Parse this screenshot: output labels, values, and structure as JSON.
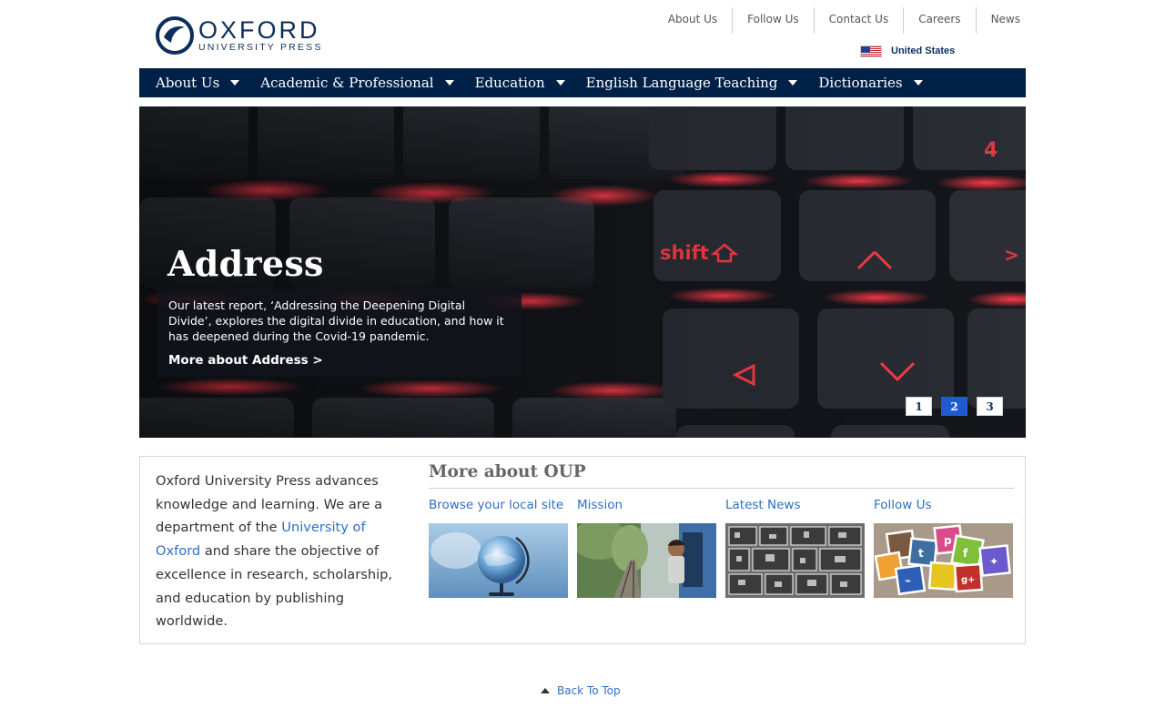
{
  "header": {
    "logo": {
      "word": "OXFORD",
      "sub": "UNIVERSITY PRESS"
    },
    "utility_links": [
      "About Us",
      "Follow Us",
      "Contact Us",
      "Careers",
      "News"
    ],
    "region": {
      "label": "United States",
      "icon": "us-flag-icon"
    }
  },
  "nav": {
    "items": [
      "About Us",
      "Academic & Professional",
      "Education",
      "English Language Teaching",
      "Dictionaries"
    ],
    "dropdown_icon": "caret-down-icon"
  },
  "hero": {
    "title": "Address",
    "description": "Our latest report, ‘Addressing the Deepening Digital Divide’, explores the digital divide in education, and how it has deepened during the Covid-19 pandemic.",
    "link": "More about Address >",
    "pager": [
      "1",
      "2",
      "3"
    ],
    "active_page": "2",
    "image_icon": "keyboard-photo-icon"
  },
  "intro": {
    "text_before": "Oxford University Press advances knowledge and learning. We are a department of the ",
    "link": "University of Oxford",
    "text_after": " and share the objective of excellence in research, scholarship, and education by publishing worldwide."
  },
  "more": {
    "title": "More about OUP",
    "cards": [
      {
        "title": "Browse your local site",
        "image": "globe-photo-icon"
      },
      {
        "title": "Mission",
        "image": "train-child-photo-icon"
      },
      {
        "title": "Latest News",
        "image": "printing-type-photo-icon"
      },
      {
        "title": "Follow Us",
        "image": "social-media-collage-icon"
      }
    ]
  },
  "back_to_top": "Back To Top",
  "colors": {
    "navy": "#002147",
    "link": "#2e6fc4",
    "active_page": "#1f5bd0"
  }
}
